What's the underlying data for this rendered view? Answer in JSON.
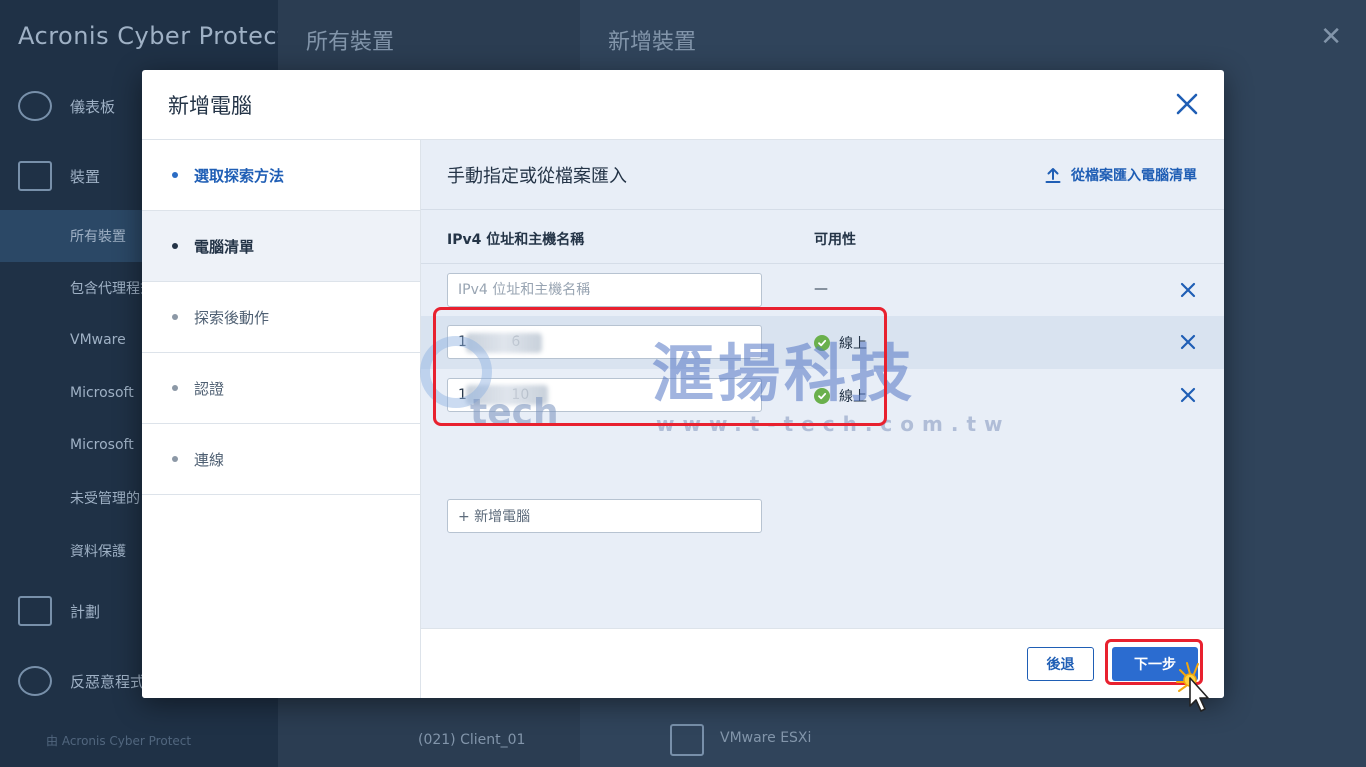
{
  "background": {
    "brand": "Acronis Cyber Protect",
    "nav": [
      {
        "label": "儀表板",
        "icon": "dashboard-icon"
      },
      {
        "label": "裝置",
        "icon": "monitor-icon"
      },
      {
        "label": "所有裝置"
      },
      {
        "label": "包含代理程式"
      },
      {
        "label": "VMware"
      },
      {
        "label": "Microsoft"
      },
      {
        "label": "Microsoft"
      },
      {
        "label": "未受管理的"
      },
      {
        "label": "資料保護"
      },
      {
        "label": "計劃",
        "icon": "plans-icon"
      },
      {
        "label": "反惡意程式",
        "icon": "shield-icon"
      }
    ],
    "footer": "由 Acronis Cyber Protect",
    "panel2_title": "所有裝置",
    "panel2_row": "(021) Client_01",
    "panel3_title": "新增裝置",
    "panel3_row": "VMware ESXi"
  },
  "modal": {
    "title": "新增電腦",
    "steps": [
      {
        "label": "選取探索方法",
        "state": "done"
      },
      {
        "label": "電腦清單",
        "state": "current"
      },
      {
        "label": "探索後動作",
        "state": "pending"
      },
      {
        "label": "認證",
        "state": "pending"
      },
      {
        "label": "連線",
        "state": "pending"
      }
    ],
    "content_title": "手動指定或從檔案匯入",
    "import_label": "從檔案匯入電腦清單",
    "table": {
      "col_ip": "IPv4 位址和主機名稱",
      "col_avail": "可用性",
      "input_placeholder": "IPv4 位址和主機名稱",
      "empty_avail": "—",
      "rows": [
        {
          "ip": "1          6",
          "status": "線上"
        },
        {
          "ip": "1          10",
          "status": "線上"
        }
      ],
      "add_label": "+ 新增電腦"
    },
    "footer": {
      "back_label": "後退",
      "next_label": "下一步"
    }
  },
  "watermark": {
    "brand": "滙揚科技",
    "logo_text": "tech",
    "url": "www.t-tech.com.tw"
  },
  "colors": {
    "accent": "#2b6cd0",
    "link": "#1f5eb5",
    "online": "#6ab04c",
    "highlight": "#e8212f"
  }
}
